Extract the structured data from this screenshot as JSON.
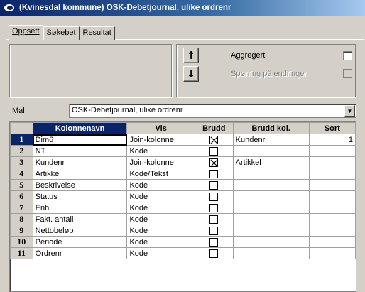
{
  "window": {
    "title": "(Kvinesdal kommune) OSK-Debetjournal, ulike ordrenr"
  },
  "tabs": [
    {
      "label": "Oppsett"
    },
    {
      "label": "Søkebet"
    },
    {
      "label": "Resultat"
    }
  ],
  "options": {
    "up_icon": "↑",
    "down_icon": "↓",
    "aggregert_label": "Aggregert",
    "aggregert_checked": false,
    "sporring_label": "Spørring på endringer",
    "sporring_checked": false,
    "sporring_enabled": false
  },
  "mal": {
    "label": "Mal",
    "value": "OSK-Debetjournal, ulike ordrenr",
    "dropdown_icon": "▼"
  },
  "grid": {
    "columns": [
      "Kolonnenavn",
      "Vis",
      "Brudd",
      "Brudd kol.",
      "Sort"
    ],
    "rows": [
      {
        "n": "1",
        "navn": "Dim6",
        "vis": "Join-kolonne",
        "brudd": true,
        "brudd_kol": "Kundenr",
        "sort": "1"
      },
      {
        "n": "2",
        "navn": "NT",
        "vis": "Kode",
        "brudd": false,
        "brudd_kol": "",
        "sort": ""
      },
      {
        "n": "3",
        "navn": "Kundenr",
        "vis": "Join-kolonne",
        "brudd": true,
        "brudd_kol": "Artikkel",
        "sort": ""
      },
      {
        "n": "4",
        "navn": "Artikkel",
        "vis": "Kode/Tekst",
        "brudd": false,
        "brudd_kol": "",
        "sort": ""
      },
      {
        "n": "5",
        "navn": "Beskrivelse",
        "vis": "Kode",
        "brudd": false,
        "brudd_kol": "",
        "sort": ""
      },
      {
        "n": "6",
        "navn": "Status",
        "vis": "Kode",
        "brudd": false,
        "brudd_kol": "",
        "sort": ""
      },
      {
        "n": "7",
        "navn": "Enh",
        "vis": "Kode",
        "brudd": false,
        "brudd_kol": "",
        "sort": ""
      },
      {
        "n": "8",
        "navn": "Fakt. antall",
        "vis": "Kode",
        "brudd": false,
        "brudd_kol": "",
        "sort": ""
      },
      {
        "n": "9",
        "navn": "Nettobeløp",
        "vis": "Kode",
        "brudd": false,
        "brudd_kol": "",
        "sort": ""
      },
      {
        "n": "10",
        "navn": "Periode",
        "vis": "Kode",
        "brudd": false,
        "brudd_kol": "",
        "sort": ""
      },
      {
        "n": "11",
        "navn": "Ordrenr",
        "vis": "Kode",
        "brudd": false,
        "brudd_kol": "",
        "sort": ""
      }
    ]
  }
}
